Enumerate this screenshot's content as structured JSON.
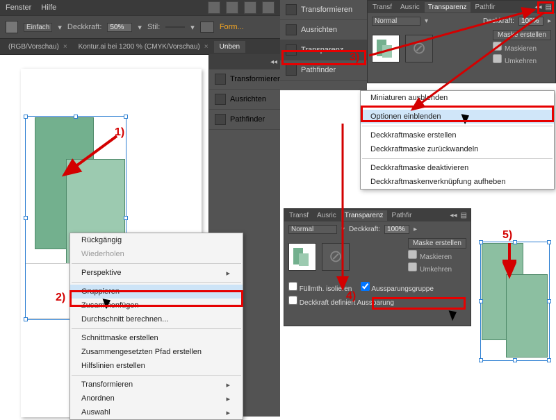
{
  "menu": {
    "fenster": "Fenster",
    "hilfe": "Hilfe"
  },
  "toolbar": {
    "stroke_mode": "Einfach",
    "opacity_label": "Deckkraft:",
    "opacity_value": "50%",
    "style_label": "Stil:",
    "style_value": "",
    "formbtn": "Form..."
  },
  "tabs": {
    "t1": "(RGB/Vorschau)",
    "t2": "Kontur.ai bei 1200 % (CMYK/Vorschau)",
    "t3": "Unben"
  },
  "sidepanel": {
    "transform": "Transformieren",
    "align": "Ausrichten",
    "pathfinder": "Pathfinder",
    "transparency": "Transparenz"
  },
  "ctx": {
    "undo": "Rückgängig",
    "redo": "Wiederholen",
    "perspective": "Perspektive",
    "group": "Gruppieren",
    "join": "Zusammenfügen",
    "avg": "Durchschnitt berechnen...",
    "clip": "Schnittmaske erstellen",
    "compound": "Zusammengesetzten Pfad erstellen",
    "guides": "Hilfslinien erstellen",
    "transform": "Transformieren",
    "arrange": "Anordnen",
    "select": "Auswahl"
  },
  "transp": {
    "tab_transf": "Transf",
    "tab_ausric": "Ausric",
    "tab_transparenz": "Transparenz",
    "tab_pathfir": "Pathfir",
    "mode": "Normal",
    "opacity_label": "Deckkraft:",
    "opacity_value": "100%",
    "make_mask": "Maske erstellen",
    "cb_mask": "Maskieren",
    "cb_invert": "Umkehren",
    "cb_isolate": "Füllmth. isolieren",
    "cb_knockout": "Aussparungsgruppe",
    "cb_define": "Deckkraft definiert Aussparung"
  },
  "flyout": {
    "hide_thumbs": "Miniaturen ausblenden",
    "show_opts": "Optionen einblenden",
    "make_opmask": "Deckkraftmaske erstellen",
    "revert_opmask": "Deckkraftmaske zurückwandeln",
    "disable_opmask": "Deckkraftmaske deaktivieren",
    "unlink_opmask": "Deckkraftmaskenverknüpfung aufheben"
  },
  "ann": {
    "n1": "1)",
    "n2": "2)",
    "n3": "3)",
    "n4": "4)",
    "n5": "5)"
  }
}
